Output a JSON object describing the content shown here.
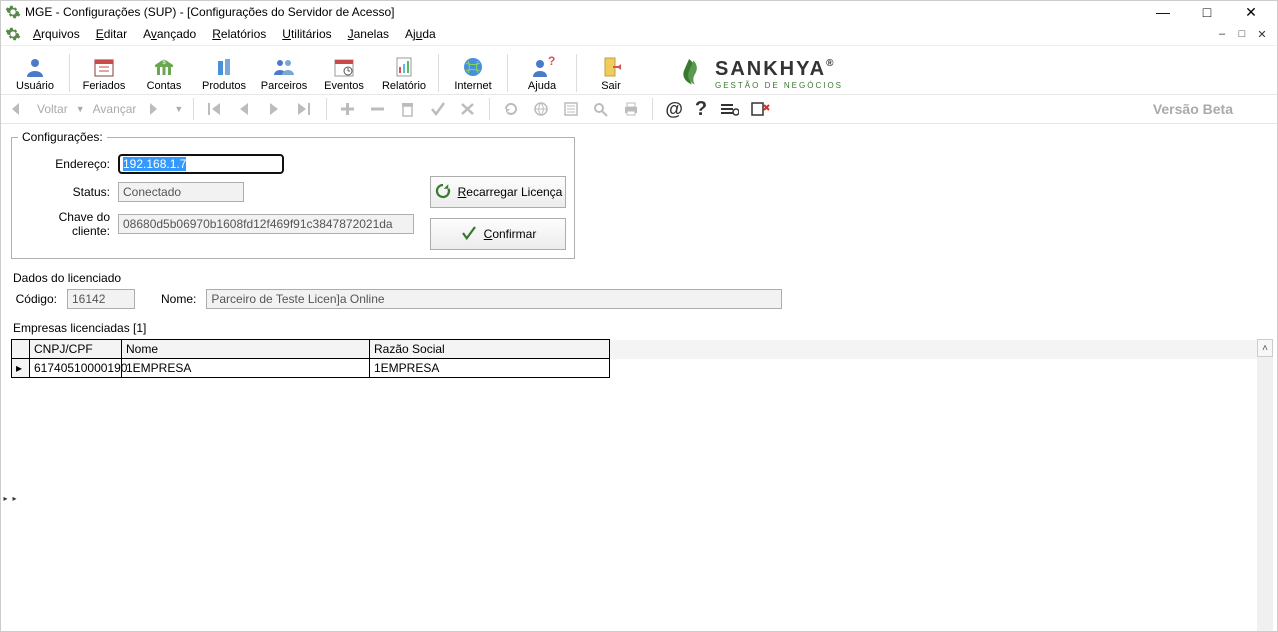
{
  "title": "MGE - Configurações (SUP) - [Configurações do Servidor de Acesso]",
  "menu": {
    "arquivos": "Arquivos",
    "editar": "Editar",
    "avancado": "Avançado",
    "relatorios": "Relatórios",
    "utilitarios": "Utilitários",
    "janelas": "Janelas",
    "ajuda": "Ajuda"
  },
  "toolbar": {
    "usuario": "Usuário",
    "feriados": "Feriados",
    "contas": "Contas",
    "produtos": "Produtos",
    "parceiros": "Parceiros",
    "eventos": "Eventos",
    "relatorio": "Relatório",
    "internet": "Internet",
    "ajuda": "Ajuda",
    "sair": "Sair"
  },
  "brand": {
    "name": "SANKHYA",
    "tag": "GESTÃO DE NEGÓCIOS",
    "reg": "®"
  },
  "nav": {
    "voltar": "Voltar",
    "avancar": "Avançar",
    "beta": "Versão Beta"
  },
  "config": {
    "legend": "Configurações:",
    "endereco_label": "Endereço:",
    "endereco_value": "192.168.1.7",
    "status_label": "Status:",
    "status_value": "Conectado",
    "chave_label": "Chave do cliente:",
    "chave_value": "08680d5b06970b1608fd12f469f91c3847872021da",
    "recarregar": "Recarregar Licença",
    "confirmar": "Confirmar"
  },
  "licenciado": {
    "title": "Dados do licenciado",
    "codigo_label": "Código:",
    "codigo_value": "16142",
    "nome_label": "Nome:",
    "nome_value": "Parceiro de Teste Licen]a Online"
  },
  "empresas": {
    "title": "Empresas licenciadas [1]",
    "columns": {
      "cnpj": "CNPJ/CPF",
      "nome": "Nome",
      "razao": "Razão Social"
    },
    "rows": [
      {
        "cnpj": "61740510000190",
        "nome": "1EMPRESA",
        "razao": "1EMPRESA"
      }
    ]
  }
}
